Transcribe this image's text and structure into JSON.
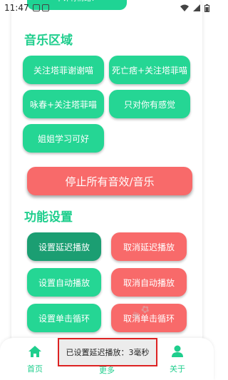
{
  "status_bar": {
    "time": "11:47"
  },
  "top_button": {
    "label": "不许有情绪！"
  },
  "music_section": {
    "title": "音乐区域",
    "buttons": [
      "关注塔菲谢谢喵",
      "死亡痞+关注塔菲喵",
      "咏春+关注塔菲喵",
      "只对你有感觉",
      "姐姐学习可好"
    ]
  },
  "stop_button": {
    "label": "停止所有音效/音乐"
  },
  "function_section": {
    "title": "功能设置",
    "left_buttons": [
      "设置延迟播放",
      "设置自动播放",
      "设置单击循环"
    ],
    "right_buttons": [
      "取消延迟播放",
      "取消自动播放",
      "取消单击循环"
    ]
  },
  "bottom_nav": {
    "items": [
      {
        "label": "首页",
        "icon": "home-icon"
      },
      {
        "label": "更多",
        "icon": "more-icon"
      },
      {
        "label": "关于",
        "icon": "person-icon"
      }
    ]
  },
  "toast": {
    "text": "已设置延迟播放：3毫秒"
  },
  "colors": {
    "accent": "#1fce8d",
    "green": "#25d694",
    "red": "#f86a6a"
  }
}
